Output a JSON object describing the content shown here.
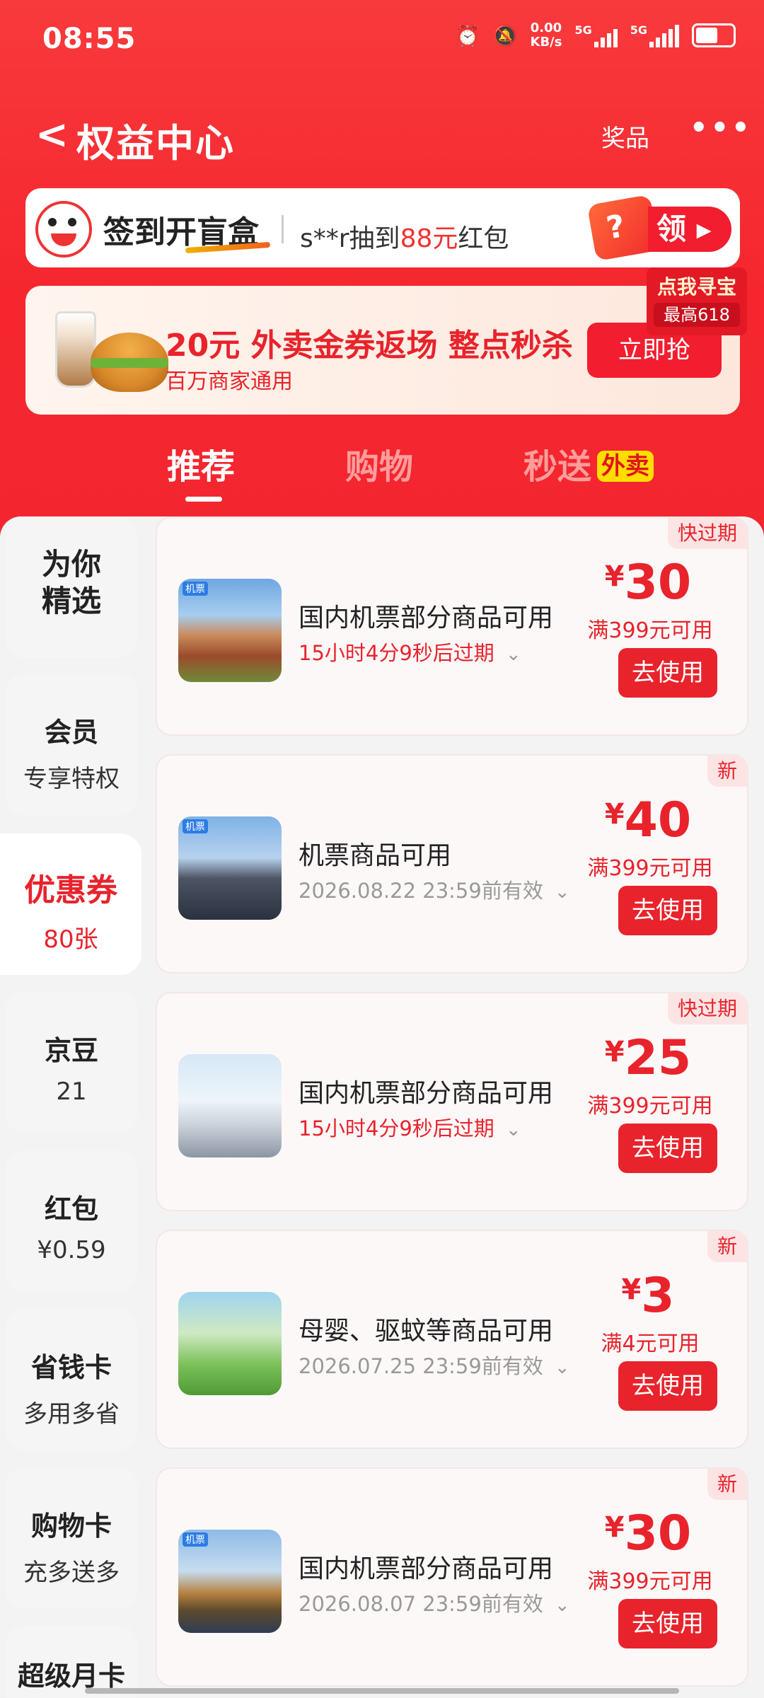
{
  "status": {
    "time": "08:55",
    "speed_value": "0.00",
    "speed_unit": "KB/s",
    "net1": "5G",
    "net2": "5G"
  },
  "nav": {
    "back": "<",
    "title": "权益中心",
    "prize": "奖品",
    "more": "•••"
  },
  "signin": {
    "label": "签到开盲盒",
    "ticker_prefix": "s**r抽到",
    "ticker_amount": "88元",
    "ticker_suffix": "红包",
    "gift": "?",
    "get": "领 ▸"
  },
  "treasure": {
    "line1": "点我寻宝",
    "line2": "最高618"
  },
  "promo": {
    "headline": "20元 外卖金券返场 整点秒杀",
    "sub": "百万商家通用",
    "button": "立即抢"
  },
  "tabs": [
    {
      "label": "推荐"
    },
    {
      "label": "购物"
    },
    {
      "label": "秒送",
      "badge": "外卖"
    }
  ],
  "sidebar": [
    {
      "a": "为你\n精选",
      "b": ""
    },
    {
      "a": "会员",
      "b": "专享特权"
    },
    {
      "a": "优惠券",
      "b": "80张"
    },
    {
      "a": "京豆",
      "b": "21"
    },
    {
      "a": "红包",
      "b": "¥0.59"
    },
    {
      "a": "省钱卡",
      "b": "多用多省"
    },
    {
      "a": "购物卡",
      "b": "充多送多"
    },
    {
      "a": "超级月卡",
      "b": ""
    }
  ],
  "coupons": [
    {
      "tag": "快过期",
      "name": "国内机票部分商品可用",
      "expire": "15小时4分9秒后过期",
      "symbol": "¥",
      "amount": "30",
      "cond": "满399元可用",
      "button": "去使用",
      "mini": "机票"
    },
    {
      "tag": "新",
      "name": "机票商品可用",
      "expire": "2026.08.22 23:59前有效",
      "symbol": "¥",
      "amount": "40",
      "cond": "满399元可用",
      "button": "去使用",
      "mini": "机票"
    },
    {
      "tag": "快过期",
      "name": "国内机票部分商品可用",
      "expire": "15小时4分9秒后过期",
      "symbol": "¥",
      "amount": "25",
      "cond": "满399元可用",
      "button": "去使用",
      "mini": ""
    },
    {
      "tag": "新",
      "name": "母婴、驱蚊等商品可用",
      "expire": "2026.07.25 23:59前有效",
      "symbol": "¥",
      "amount": "3",
      "cond": "满4元可用",
      "button": "去使用",
      "mini": ""
    },
    {
      "tag": "新",
      "name": "国内机票部分商品可用",
      "expire": "2026.08.07 23:59前有效",
      "symbol": "¥",
      "amount": "30",
      "cond": "满399元可用",
      "button": "去使用",
      "mini": "机票"
    }
  ],
  "chevron": "⌄",
  "colors": {
    "brand_red": "#e8232c",
    "header_red": "#f5262e"
  }
}
